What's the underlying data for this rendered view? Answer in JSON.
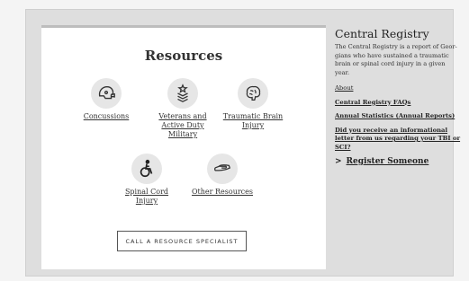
{
  "resources": {
    "title": "Resources",
    "items": [
      {
        "label": "Concussions",
        "icon": "football-helmet-icon"
      },
      {
        "label": "Veterans and Active Duty Military",
        "icon": "military-rank-icon"
      },
      {
        "label": "Traumatic Brain Injury",
        "icon": "brain-icon"
      },
      {
        "label": "Spinal Cord Injury",
        "icon": "wheelchair-icon"
      },
      {
        "label": "Other Resources",
        "icon": "helping-hand-icon"
      }
    ],
    "cta_label": "CALL A RESOURCE SPECIALIST"
  },
  "registry": {
    "title": "Central Registry",
    "description": "The Central Registry is a report of Geor-gians who have sustained a traumatic brain or spinal cord injury in a given year.",
    "links": [
      {
        "label": "About",
        "bold": false
      },
      {
        "label": "Central Registry FAQs",
        "bold": true
      },
      {
        "label": "Annual Statistics (Annual Reports)",
        "bold": true
      },
      {
        "label": "Did you receive an informational letter from us regarding your TBI or SCI?",
        "bold": true
      }
    ],
    "register_label": "Register Someone",
    "register_chevron": ">"
  },
  "colors": {
    "card": "#ffffff",
    "frame": "#dedede",
    "icon_bg": "#e6e6e6",
    "text": "#222222"
  }
}
